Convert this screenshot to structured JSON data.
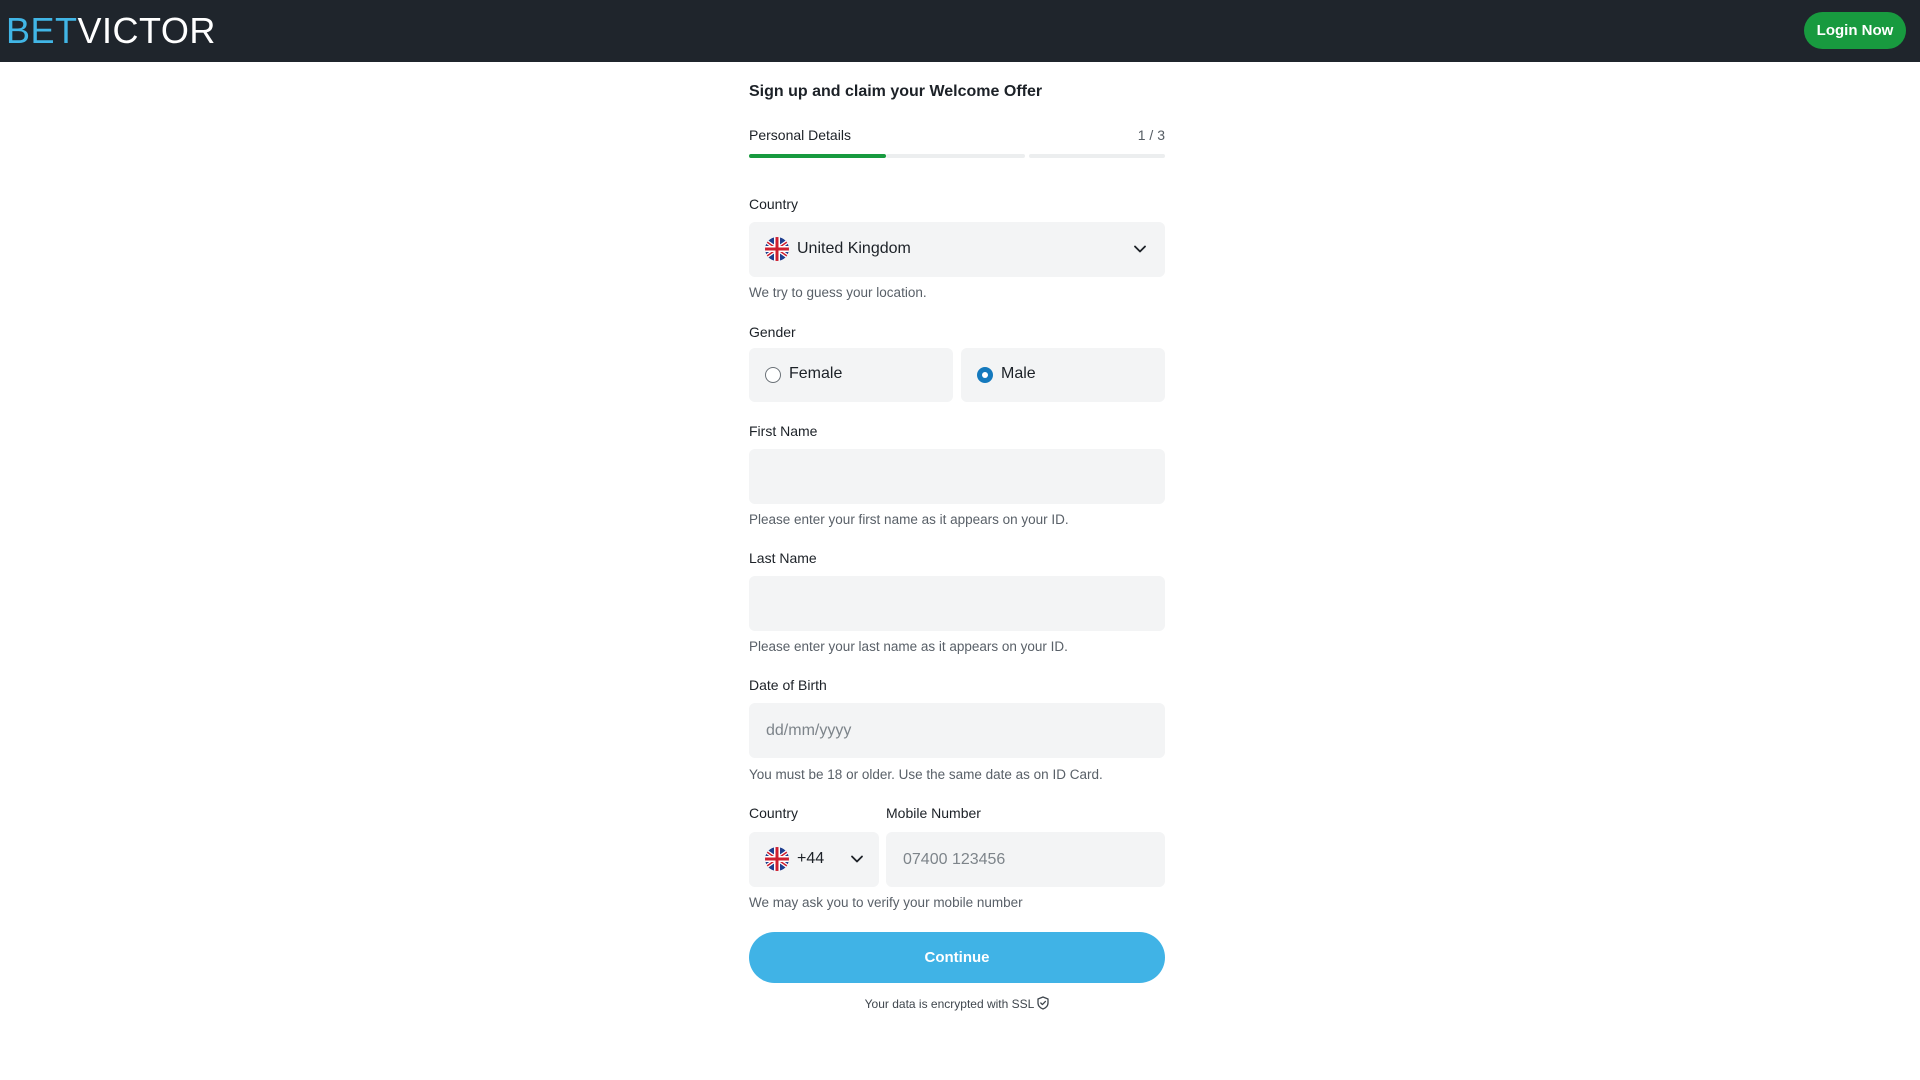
{
  "header": {
    "logo_bet": "BET",
    "logo_victor": "VICTOR",
    "login_label": "Login Now",
    "login_color": "#189a3f"
  },
  "form": {
    "title": "Sign up and claim your Welcome Offer",
    "step_label": "Personal Details",
    "step_count": "1 / 3",
    "progress": {
      "current_step": 1,
      "total_steps": 3,
      "first_step_fill": 1.0
    },
    "country": {
      "label": "Country",
      "value": "United Kingdom",
      "flag_icon": "uk-flag-icon",
      "hint": "We try to guess your location."
    },
    "gender": {
      "label": "Gender",
      "options": [
        {
          "label": "Female",
          "selected": false
        },
        {
          "label": "Male",
          "selected": true
        }
      ]
    },
    "first_name": {
      "label": "First Name",
      "value": "",
      "hint": "Please enter your first name as it appears on your ID."
    },
    "last_name": {
      "label": "Last Name",
      "value": "",
      "hint": "Please enter your last name as it appears on your ID."
    },
    "dob": {
      "label": "Date of Birth",
      "placeholder": "dd/mm/yyyy",
      "hint": "You must be 18 or older. Use the same date as on ID Card."
    },
    "phone": {
      "country_label": "Country",
      "number_label": "Mobile Number",
      "dial_code": "+44",
      "placeholder": "07400 123456",
      "hint": "We may ask you to verify your mobile number"
    },
    "continue_label": "Continue",
    "continue_color": "#40b3e6",
    "ssl_text": "Your data is encrypted with SSL",
    "ssl_icon": "shield-check-icon"
  }
}
